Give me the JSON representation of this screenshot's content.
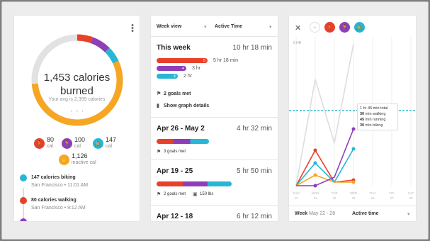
{
  "colors": {
    "ring_gray": "#e2e2e2",
    "walking": "#e8412a",
    "running": "#8e3fb8",
    "biking": "#27b7d4",
    "inactive": "#f6a623",
    "dashed": "#35b9c9"
  },
  "summary": {
    "calories": "1,453 calories",
    "burned": "burned",
    "average": "Your avg is 2,399 calories",
    "stats": [
      {
        "icon": "walking-icon",
        "value": "80",
        "unit": "cal"
      },
      {
        "icon": "running-icon",
        "value": "100",
        "unit": "cal"
      },
      {
        "icon": "biking-icon",
        "value": "147",
        "unit": "cal"
      }
    ],
    "inactive": {
      "value": "1,126",
      "unit": "inactive cal"
    },
    "timeline": [
      {
        "title": "147 calories biking",
        "sub": "San Francisco • 11:01 AM"
      },
      {
        "title": "80 calories walking",
        "sub": "San Francisco • 9:12 AM"
      }
    ]
  },
  "weeks": {
    "header_view": "Week view",
    "header_metric": "Active Time",
    "this_week": {
      "title": "This week",
      "total": "10 hr 18 min",
      "bars": [
        {
          "num": "5",
          "label": "5 hr 18 min"
        },
        {
          "num": "4",
          "label": "3 hr"
        },
        {
          "num": "4",
          "label": "2 hr"
        }
      ],
      "goals": "2 goals met",
      "graph": "Show graph details"
    },
    "list": [
      {
        "title": "Apr 26 - May 2",
        "total": "4 hr 32 min",
        "goals": "3 goals met",
        "extra": ""
      },
      {
        "title": "Apr 19 - 25",
        "total": "5 hr 50 min",
        "goals": "2 goals met",
        "extra": "150 lbs"
      },
      {
        "title": "Apr 12 - 18",
        "total": "6 hr 12 min",
        "goals": "",
        "extra": ""
      }
    ]
  },
  "detail": {
    "y_label": "5 HR",
    "tooltip": [
      {
        "bold": "1",
        "rest": " hr "
      },
      {
        "bold": "45",
        "rest": " min total"
      }
    ],
    "tip_line1": "1 hr 45 min total",
    "tip_line2_b": "30",
    "tip_line2": " min walking",
    "tip_line3_b": "45",
    "tip_line3": " min running",
    "tip_line4_b": "30",
    "tip_line4": " min biking",
    "days": [
      "SUN",
      "MON",
      "TUE",
      "WED",
      "THU",
      "FRI",
      "SAT"
    ],
    "dates": [
      "22",
      "23",
      "24",
      "25",
      "26",
      "27",
      "28"
    ],
    "footer_week": "Week",
    "footer_range": "May 22 - 28",
    "footer_metric": "Active time"
  }
}
